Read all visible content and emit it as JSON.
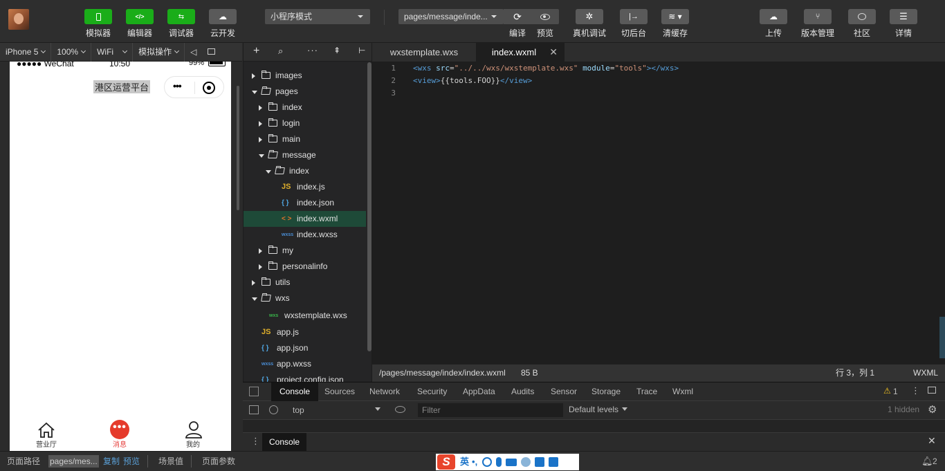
{
  "toolbar": {
    "buttons": [
      {
        "label": "模拟器",
        "icon": "phone-icon",
        "green": true
      },
      {
        "label": "编辑器",
        "icon": "code-icon",
        "green": true
      },
      {
        "label": "调试器",
        "icon": "debug-icon",
        "green": true
      },
      {
        "label": "云开发",
        "icon": "cloud-icon",
        "green": false
      }
    ],
    "mode_select": "小程序模式",
    "page_select": "pages/message/inde...",
    "compile_label": "编译",
    "preview_label": "预览",
    "real_debug_label": "真机调试",
    "background_label": "切后台",
    "clear_cache_label": "清缓存",
    "upload_label": "上传",
    "version_label": "版本管理",
    "community_label": "社区",
    "details_label": "详情",
    "green_color": "#1aad19"
  },
  "device_bar": {
    "device": "iPhone 5",
    "zoom": "100%",
    "network": "WiFi",
    "ops": "模拟操作"
  },
  "simulator": {
    "carrier": "●●●●● WeChat",
    "time": "10:50",
    "battery": "99%",
    "nav_title": "港区运营平台",
    "capsule_dots": "•••",
    "tabs": [
      {
        "label": "营业厅",
        "icon": "home-icon"
      },
      {
        "label": "消息",
        "icon": "message-icon",
        "badge": "•••"
      },
      {
        "label": "我的",
        "icon": "user-icon"
      }
    ],
    "active_color": "#e64340"
  },
  "explorer": {
    "rows": [
      {
        "label": "images",
        "type": "folder",
        "depth": 0,
        "expanded": false
      },
      {
        "label": "pages",
        "type": "folder",
        "depth": 0,
        "expanded": true
      },
      {
        "label": "index",
        "type": "folder",
        "depth": 1,
        "expanded": false
      },
      {
        "label": "login",
        "type": "folder",
        "depth": 1,
        "expanded": false
      },
      {
        "label": "main",
        "type": "folder",
        "depth": 1,
        "expanded": false
      },
      {
        "label": "message",
        "type": "folder",
        "depth": 1,
        "expanded": true
      },
      {
        "label": "index",
        "type": "folder",
        "depth": 2,
        "expanded": true
      },
      {
        "label": "index.js",
        "type": "js",
        "depth": 3
      },
      {
        "label": "index.json",
        "type": "json",
        "depth": 3
      },
      {
        "label": "index.wxml",
        "type": "wxml",
        "depth": 3,
        "selected": true
      },
      {
        "label": "index.wxss",
        "type": "wxss",
        "depth": 3
      },
      {
        "label": "my",
        "type": "folder",
        "depth": 1,
        "expanded": false
      },
      {
        "label": "personalinfo",
        "type": "folder",
        "depth": 1,
        "expanded": false
      },
      {
        "label": "utils",
        "type": "folder",
        "depth": 0,
        "expanded": false
      },
      {
        "label": "wxs",
        "type": "folder",
        "depth": 0,
        "expanded": true
      },
      {
        "label": "wxstemplate.wxs",
        "type": "wxs",
        "depth": 1
      },
      {
        "label": "app.js",
        "type": "js",
        "depth": 0
      },
      {
        "label": "app.json",
        "type": "json",
        "depth": 0
      },
      {
        "label": "app.wxss",
        "type": "wxss",
        "depth": 0
      },
      {
        "label": "project.config.json",
        "type": "json",
        "depth": 0
      }
    ],
    "icon_glyphs": {
      "js": "JS",
      "json": "{ }",
      "wxml": "< >",
      "wxss": "wxss",
      "wxs": "wxs"
    }
  },
  "editor": {
    "tabs": [
      {
        "label": "wxstemplate.wxs",
        "active": false
      },
      {
        "label": "index.wxml",
        "active": true
      }
    ],
    "lines": [
      {
        "num": "1",
        "parts": [
          {
            "t": "tag",
            "v": "<wxs "
          },
          {
            "t": "attr",
            "v": "src"
          },
          {
            "t": "plain",
            "v": "="
          },
          {
            "t": "str",
            "v": "\"../../wxs/wxstemplate.wxs\""
          },
          {
            "t": "plain",
            "v": " "
          },
          {
            "t": "attr",
            "v": "module"
          },
          {
            "t": "plain",
            "v": "="
          },
          {
            "t": "str",
            "v": "\"tools\""
          },
          {
            "t": "tag",
            "v": "></wxs>"
          }
        ]
      },
      {
        "num": "2",
        "parts": [
          {
            "t": "tag",
            "v": "<view>"
          },
          {
            "t": "plain",
            "v": "{{tools.FOO}}"
          },
          {
            "t": "tag",
            "v": "</view>"
          }
        ]
      },
      {
        "num": "3",
        "parts": []
      }
    ],
    "status": {
      "path": "/pages/message/index/index.wxml",
      "size": "85 B",
      "position": "行 3，列 1",
      "language": "WXML"
    }
  },
  "devtools": {
    "tabs": [
      "Console",
      "Sources",
      "Network",
      "Security",
      "AppData",
      "Audits",
      "Sensor",
      "Storage",
      "Trace",
      "Wxml"
    ],
    "active_tab": "Console",
    "warnings": "1",
    "context": "top",
    "filter_placeholder": "Filter",
    "levels": "Default levels",
    "hidden": "1 hidden",
    "drawer_tab": "Console"
  },
  "statusbar": {
    "page_path_label": "页面路径",
    "page_path": "pages/mes...",
    "copy_label": "复制",
    "preview_label": "预览",
    "scene_label": "场景值",
    "params_label": "页面参数",
    "ime_text": "英",
    "notifications": "2"
  }
}
